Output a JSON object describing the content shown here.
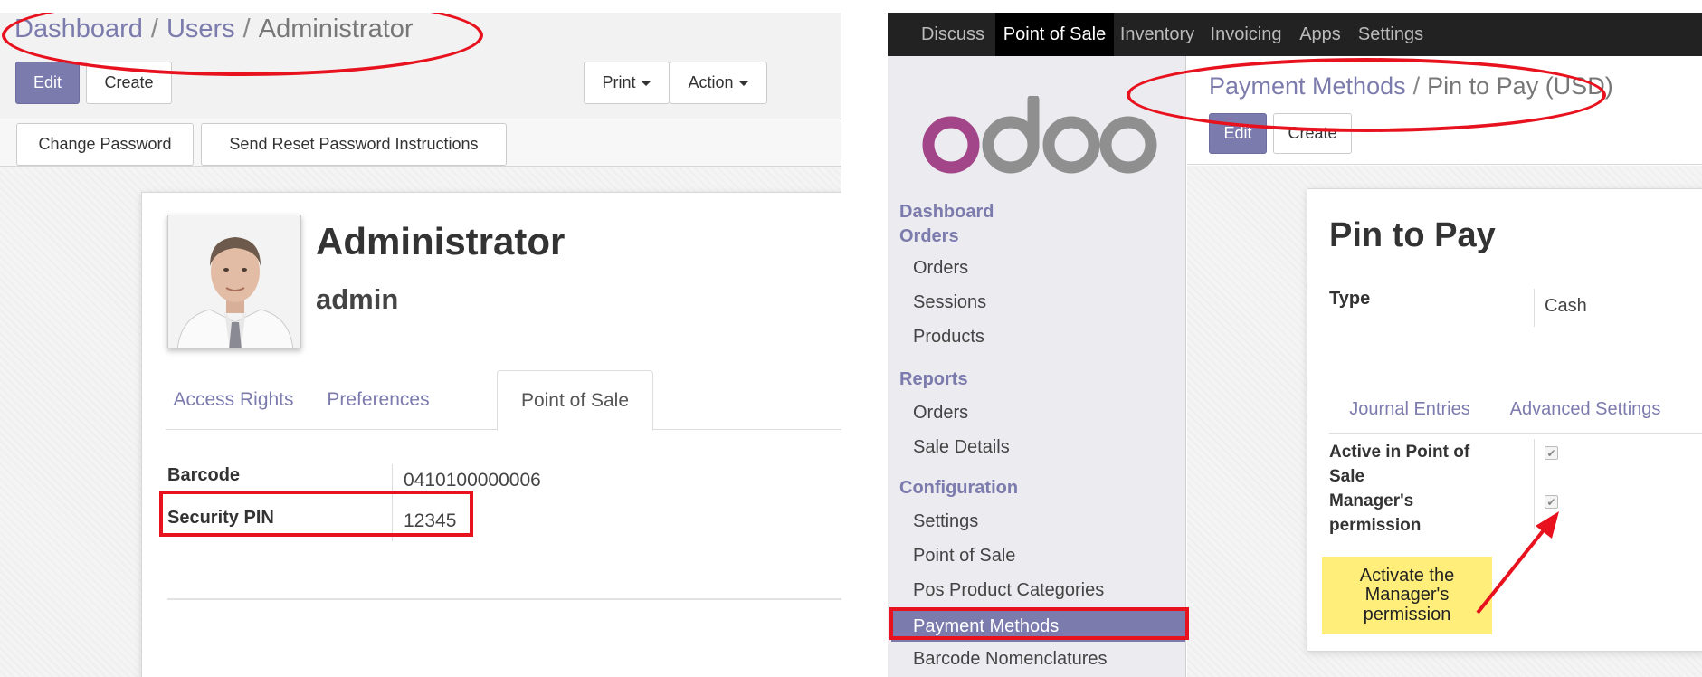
{
  "left": {
    "breadcrumb": {
      "items": [
        "Dashboard",
        "Users"
      ],
      "current": "Administrator",
      "separator": "/"
    },
    "buttons": {
      "edit": "Edit",
      "create": "Create",
      "print": "Print",
      "action": "Action"
    },
    "status_buttons": {
      "change_password": "Change Password",
      "send_reset": "Send Reset Password Instructions"
    },
    "user": {
      "name": "Administrator",
      "login": "admin"
    },
    "tabs": [
      "Access Rights",
      "Preferences",
      "Point of Sale"
    ],
    "active_tab": "Point of Sale",
    "fields": {
      "barcode_label": "Barcode",
      "barcode_value": "0410100000006",
      "pin_label": "Security PIN",
      "pin_value": "12345"
    }
  },
  "right": {
    "menu": [
      "Discuss",
      "Point of Sale",
      "Inventory",
      "Invoicing",
      "Apps",
      "Settings"
    ],
    "active_menu": "Point of Sale",
    "logo_text": "odoo",
    "sidebar": {
      "dashboard": "Dashboard",
      "orders_head": "Orders",
      "orders_items": [
        "Orders",
        "Sessions",
        "Products"
      ],
      "reports_head": "Reports",
      "reports_items": [
        "Orders",
        "Sale Details"
      ],
      "config_head": "Configuration",
      "config_items": [
        "Settings",
        "Point of Sale",
        "Pos Product Categories",
        "Payment Methods",
        "Barcode Nomenclatures"
      ],
      "active_item": "Payment Methods"
    },
    "breadcrumb": {
      "link": "Payment Methods",
      "separator": "/",
      "current": "Pin to Pay (USD)"
    },
    "buttons": {
      "edit": "Edit",
      "create": "Create"
    },
    "record": {
      "title": "Pin to Pay",
      "type_label": "Type",
      "type_value": "Cash",
      "tabs": [
        "Journal Entries",
        "Advanced Settings"
      ],
      "active_pos_label": "Active in Point of Sale",
      "active_pos_checked": true,
      "manager_label": "Manager's permission",
      "manager_checked": true
    },
    "annotation": "Activate the Manager's permission"
  },
  "colors": {
    "brand": "#7c7bad",
    "highlight": "#e8121f",
    "note_bg": "#ffef7a",
    "menubar": "#222222"
  }
}
